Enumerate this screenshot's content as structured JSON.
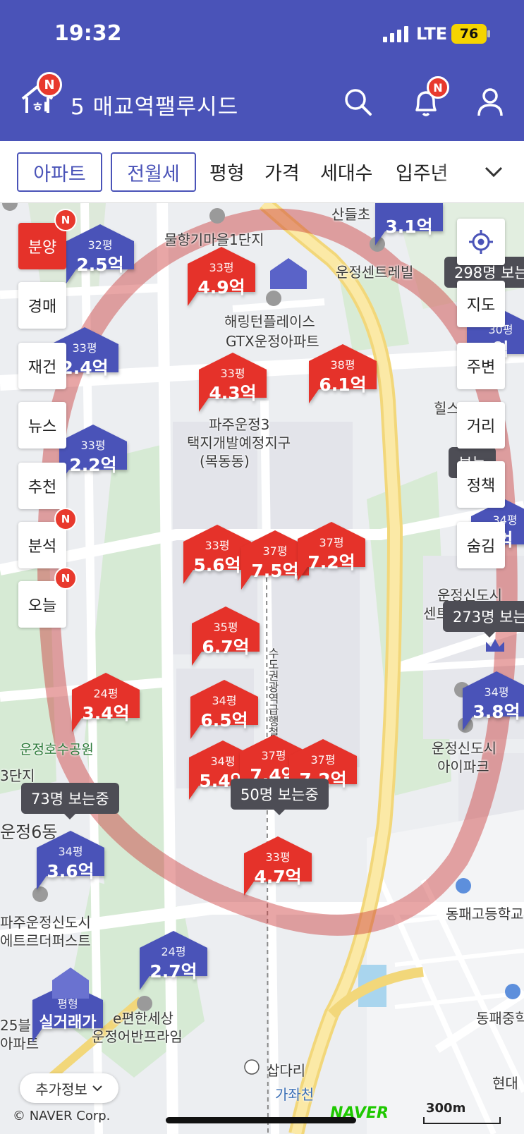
{
  "status": {
    "time": "19:32",
    "network": "LTE",
    "battery": "76"
  },
  "header": {
    "title": "5 매교역팰루시드",
    "home_badge": "N",
    "bell_badge": "N"
  },
  "filters": {
    "apt": "아파트",
    "rent": "전월세",
    "items": [
      "평형",
      "가격",
      "세대수",
      "입주년"
    ]
  },
  "side_left": [
    {
      "label": "분양",
      "badge": "N"
    },
    {
      "label": "경매",
      "badge": ""
    },
    {
      "label": "재건",
      "badge": ""
    },
    {
      "label": "뉴스",
      "badge": ""
    },
    {
      "label": "추천",
      "badge": ""
    },
    {
      "label": "분석",
      "badge": "N"
    },
    {
      "label": "오늘",
      "badge": "N"
    }
  ],
  "side_right": [
    "지도",
    "주변",
    "거리",
    "정책",
    "숨김"
  ],
  "map_labels": [
    "물향기마을1단지",
    "해링턴플레이스",
    "GTX운정아파트",
    "파주운정3",
    "택지개발예정지구",
    "(목동동)",
    "운정센트레빌",
    "산들초",
    "힐스",
    "운정신도시",
    "센트럴푸르지오",
    "운정신도시",
    "아이파크",
    "동패고등학교",
    "동패중학",
    "파주운정신도시",
    "에트르더퍼스트",
    "e편한세상",
    "운정어반프라임",
    "삽다리",
    "가좌천",
    "운정6동",
    "현대",
    "수도권광역급행철도",
    "운정호수공원",
    "3단지",
    "25블",
    "아파트"
  ],
  "pins": [
    {
      "color": "blue",
      "pyeong": "32평",
      "price": "2.5억"
    },
    {
      "color": "red",
      "pyeong": "33평",
      "price": "4.9억"
    },
    {
      "color": "blue",
      "pyeong": "",
      "price": "3.1억"
    },
    {
      "color": "blue",
      "pyeong": "33평",
      "price": "2.4억"
    },
    {
      "color": "red",
      "pyeong": "33평",
      "price": "4.3억"
    },
    {
      "color": "red",
      "pyeong": "38평",
      "price": "6.1억"
    },
    {
      "color": "blue",
      "pyeong": "30평",
      "price": "억"
    },
    {
      "color": "blue",
      "pyeong": "33평",
      "price": "2.2억"
    },
    {
      "color": "red",
      "pyeong": "33평",
      "price": "5.6억"
    },
    {
      "color": "red",
      "pyeong": "37평",
      "price": "7.5억"
    },
    {
      "color": "red",
      "pyeong": "37평",
      "price": "7.2억"
    },
    {
      "color": "blue",
      "pyeong": "34평",
      "price": "억"
    },
    {
      "color": "red",
      "pyeong": "35평",
      "price": "6.7억"
    },
    {
      "color": "red",
      "pyeong": "24평",
      "price": "3.4억"
    },
    {
      "color": "red",
      "pyeong": "34평",
      "price": "6.5억"
    },
    {
      "color": "blue",
      "pyeong": "34평",
      "price": "3.8억"
    },
    {
      "color": "red",
      "pyeong": "34평",
      "price": "5.4억"
    },
    {
      "color": "red",
      "pyeong": "37평",
      "price": "7.4억"
    },
    {
      "color": "red",
      "pyeong": "37평",
      "price": "7.2억"
    },
    {
      "color": "blue",
      "pyeong": "34평",
      "price": "3.6억"
    },
    {
      "color": "red",
      "pyeong": "33평",
      "price": "4.7억"
    },
    {
      "color": "blue",
      "pyeong": "24평",
      "price": "2.7억"
    },
    {
      "color": "blue",
      "pyeong": "평형",
      "price": "실거래가"
    }
  ],
  "viewers": [
    "298명 보는",
    "보는",
    "273명 보는",
    "73명 보는중",
    "50명 보는중"
  ],
  "more_info": "추가정보",
  "copyright": "© NAVER Corp.",
  "naver": "NAVER",
  "scale": "300m",
  "colors": {
    "header": "#4a53b8",
    "pin_red": "#e5322a",
    "pin_blue": "#4a53b8",
    "badge": "#e8392d"
  },
  "icons": [
    "home-icon",
    "search-icon",
    "bell-icon",
    "user-icon",
    "chevron-down-icon",
    "locate-icon",
    "crown-icon",
    "school-icon"
  ]
}
